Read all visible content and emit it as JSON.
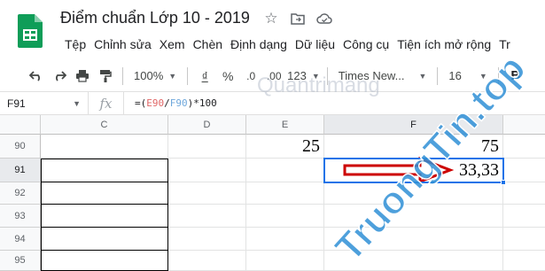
{
  "doc": {
    "title": "Điểm chuẩn Lớp 10 - 2019"
  },
  "icons": [
    "sheets-logo-icon",
    "star-icon",
    "move-folder-icon",
    "cloud-status-icon",
    "undo-icon",
    "redo-icon",
    "print-icon",
    "paint-format-icon"
  ],
  "menu": [
    "Tệp",
    "Chỉnh sửa",
    "Xem",
    "Chèn",
    "Định dạng",
    "Dữ liệu",
    "Công cụ",
    "Tiện ích mở rộng",
    "Tr"
  ],
  "toolbar": {
    "zoom": "100%",
    "currency": "₫",
    "percent": "%",
    "decimal_decrease": ".0",
    "decimal_increase": ".00",
    "more_formats": "123",
    "font": "Times New...",
    "font_size": "16",
    "bold": "B"
  },
  "formula_bar": {
    "cell_ref": "F91",
    "fx": "fx",
    "formula_prefix": "=(",
    "ref1": "E90",
    "slash": "/",
    "ref2": "F90",
    "formula_suffix": ")*100"
  },
  "columns": [
    "C",
    "D",
    "E",
    "F"
  ],
  "rows": [
    "90",
    "91",
    "92",
    "93",
    "94",
    "95"
  ],
  "cells": {
    "E90": "25",
    "F90": "75",
    "F91": "33,33"
  },
  "watermark": {
    "text1": "Quantrimang",
    "text2": "TruongTin.top"
  },
  "colors": {
    "selection": "#1a73e8",
    "sheets_green": "#0f9d58",
    "arrow_red": "#cc0000"
  }
}
